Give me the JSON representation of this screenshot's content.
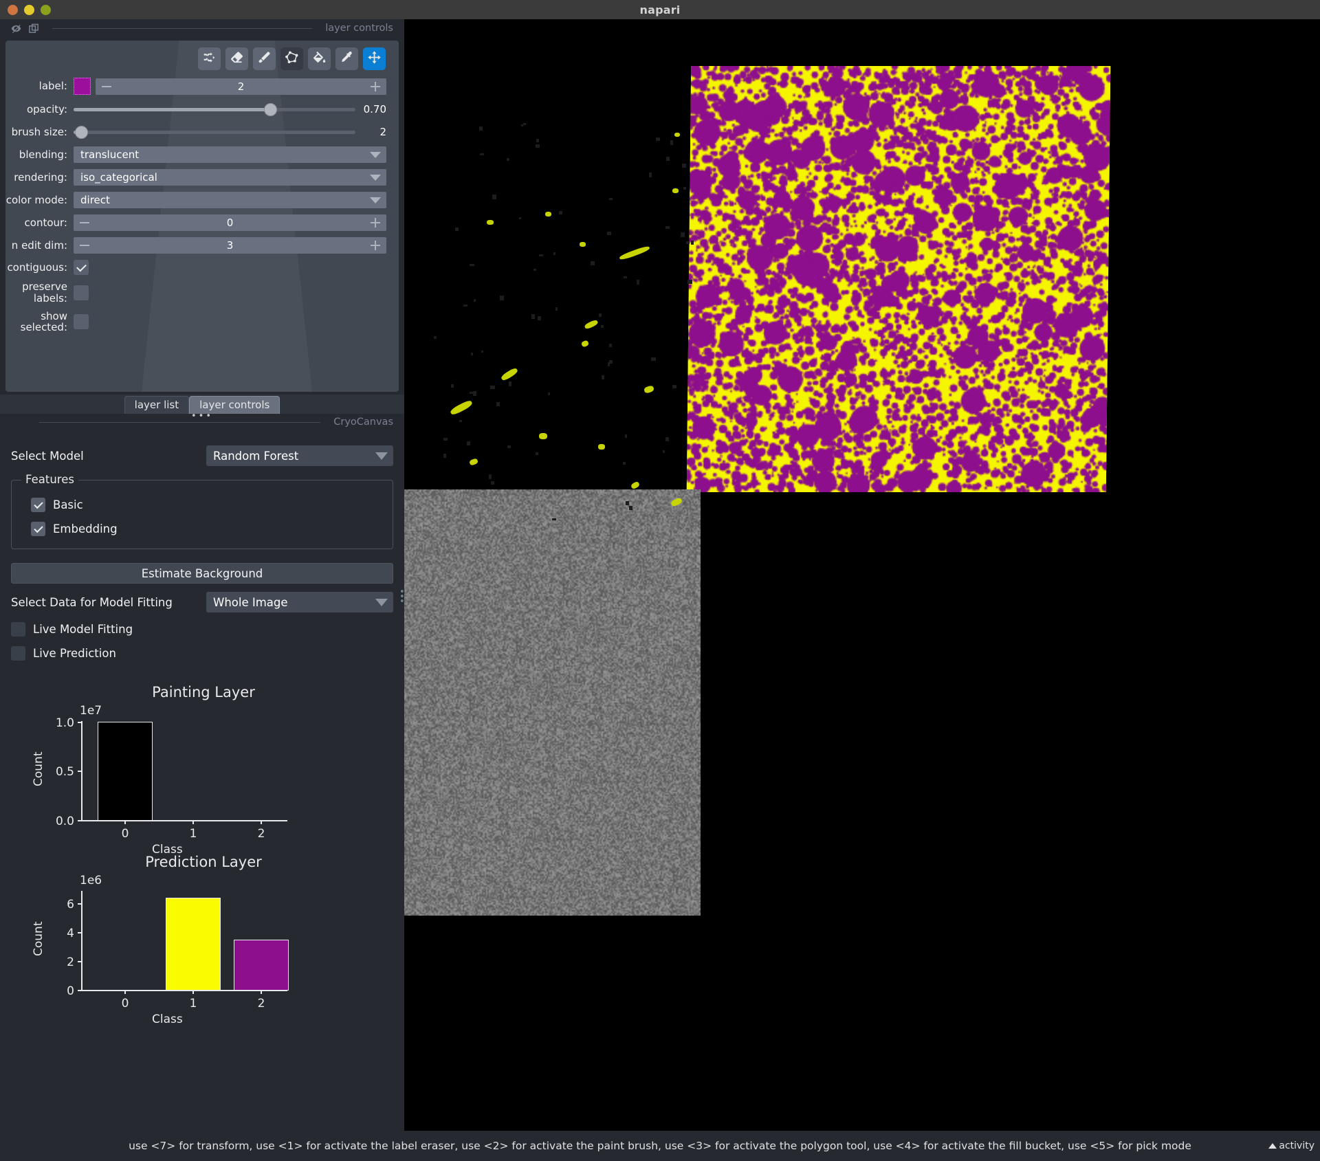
{
  "window": {
    "title": "napari",
    "traffic_lights": [
      "close-red",
      "minimize-yellow",
      "zoom-green"
    ]
  },
  "layer_controls_dock": {
    "title": "layer controls",
    "icons": [
      "visibility-off-icon",
      "copy-icon"
    ],
    "toolbar": [
      {
        "name": "shuffle-colors-button",
        "icon": "shuffle-icon",
        "state": "normal"
      },
      {
        "name": "label-eraser-button",
        "icon": "eraser-icon",
        "state": "normal"
      },
      {
        "name": "paint-brush-button",
        "icon": "paintbrush-icon",
        "state": "normal"
      },
      {
        "name": "polygon-tool-button",
        "icon": "polygon-icon",
        "state": "disabled"
      },
      {
        "name": "fill-bucket-button",
        "icon": "fill-bucket-icon",
        "state": "normal"
      },
      {
        "name": "pick-mode-button",
        "icon": "eyedropper-icon",
        "state": "normal"
      },
      {
        "name": "transform-button",
        "icon": "move-arrows-icon",
        "state": "active"
      }
    ],
    "controls": {
      "label": {
        "caption": "label:",
        "value": "2",
        "swatch_color": "#9c0f9c"
      },
      "opacity": {
        "caption": "opacity:",
        "value": "0.70",
        "fraction": 0.7
      },
      "brush_size": {
        "caption": "brush size:",
        "value": "2",
        "fraction": 0.025
      },
      "blending": {
        "caption": "blending:",
        "value": "translucent"
      },
      "rendering": {
        "caption": "rendering:",
        "value": "iso_categorical"
      },
      "color_mode": {
        "caption": "color mode:",
        "value": "direct"
      },
      "contour": {
        "caption": "contour:",
        "value": "0"
      },
      "n_edit_dim": {
        "caption": "n edit dim:",
        "value": "3"
      },
      "contiguous": {
        "caption": "contiguous:",
        "checked": true
      },
      "preserve_labels": {
        "caption": "preserve\nlabels:",
        "checked": false
      },
      "show_selected": {
        "caption": "show\nselected:",
        "checked": false
      }
    }
  },
  "tabs": [
    {
      "label": "layer list",
      "selected": false
    },
    {
      "label": "layer controls",
      "selected": true
    }
  ],
  "cryocanvas": {
    "title": "CryoCanvas",
    "icons": [
      "close-icon",
      "visibility-off-icon",
      "copy-icon"
    ],
    "select_model": {
      "label": "Select Model",
      "value": "Random Forest"
    },
    "features": {
      "legend": "Features",
      "items": [
        {
          "label": "Basic",
          "checked": true
        },
        {
          "label": "Embedding",
          "checked": true
        }
      ]
    },
    "estimate_background_button": "Estimate Background",
    "select_data": {
      "label": "Select Data for Model Fitting",
      "value": "Whole Image"
    },
    "live_model_fitting": {
      "label": "Live Model Fitting",
      "checked": false
    },
    "live_prediction": {
      "label": "Live Prediction",
      "checked": false
    }
  },
  "chart_data": [
    {
      "type": "bar",
      "title": "Painting Layer",
      "xlabel": "Class",
      "ylabel": "Count",
      "y_exponent_label": "1e7",
      "categories": [
        "0",
        "1",
        "2"
      ],
      "values": [
        10000000,
        0,
        0
      ],
      "bar_colors": [
        "#000000",
        "#000000",
        "#000000"
      ],
      "bar_edge_color": "#e8eaec",
      "yticks": [
        "0.0",
        "0.5",
        "1.0"
      ],
      "ytick_values": [
        0,
        5000000,
        10000000
      ],
      "ylim": [
        0,
        10400000
      ],
      "grid": false,
      "legend": "none"
    },
    {
      "type": "bar",
      "title": "Prediction Layer",
      "xlabel": "Class",
      "ylabel": "Count",
      "y_exponent_label": "1e6",
      "categories": [
        "0",
        "1",
        "2"
      ],
      "values": [
        0,
        6400000,
        3500000
      ],
      "bar_colors": [
        "#000000",
        "#fbfb00",
        "#8d0f8d"
      ],
      "bar_edge_color": "#e8eaec",
      "yticks": [
        "0",
        "2",
        "4",
        "6"
      ],
      "ytick_values": [
        0,
        2000000,
        4000000,
        6000000
      ],
      "ylim": [
        0,
        6900000
      ],
      "grid": false,
      "legend": "none"
    }
  ],
  "canvas": {
    "layers": [
      "prediction-segmentation-layer",
      "painting-annotations-layer",
      "cryoem-image-layer"
    ],
    "colors": {
      "class1_yellow": "#f5f500",
      "class2_purple": "#8d0f8d",
      "paint_stroke": "#c8d400",
      "background": "#000000",
      "image_gray": "#8a8a8a"
    }
  },
  "statusbar": {
    "text": "use <7> for transform, use <1> for activate the label eraser, use <2> for activate the paint brush, use <3> for activate the polygon tool, use <4> for activate the fill bucket, use <5> for pick mode",
    "activity_label": "activity"
  }
}
